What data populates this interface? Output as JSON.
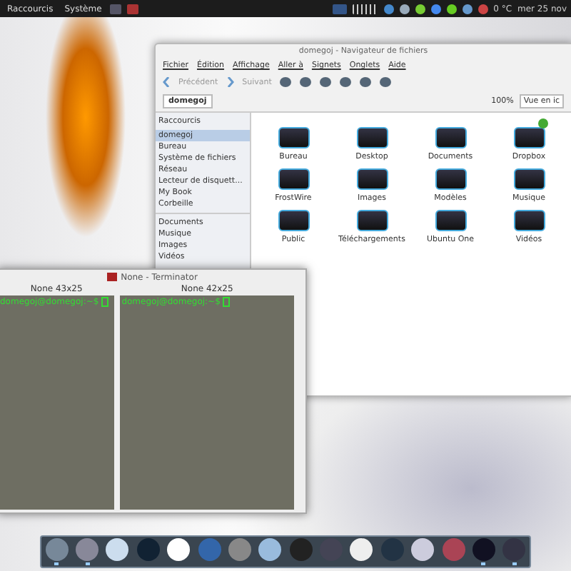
{
  "top_panel": {
    "menus": [
      "Raccourcis",
      "Système"
    ],
    "temperature": "0 °C",
    "clock": "mer 25 nov"
  },
  "file_manager": {
    "title": "domegoj - Navigateur de fichiers",
    "menu": [
      "Fichier",
      "Édition",
      "Affichage",
      "Aller à",
      "Signets",
      "Onglets",
      "Aide"
    ],
    "back": "Précédent",
    "forward": "Suivant",
    "location": "domegoj",
    "zoom": "100%",
    "view": "Vue en ic",
    "sidebar_title": "Raccourcis",
    "sidebar": [
      {
        "label": "domegoj",
        "selected": true
      },
      {
        "label": "Bureau",
        "selected": false
      },
      {
        "label": "Système de fichiers",
        "selected": false
      },
      {
        "label": "Réseau",
        "selected": false
      },
      {
        "label": "Lecteur de disquett...",
        "selected": false
      },
      {
        "label": "My Book",
        "selected": false
      },
      {
        "label": "Corbeille",
        "selected": false
      }
    ],
    "bookmarks": [
      {
        "label": "Documents",
        "selected": false
      },
      {
        "label": "Musique",
        "selected": false
      },
      {
        "label": "Images",
        "selected": false
      },
      {
        "label": "Vidéos",
        "selected": false
      }
    ],
    "items": [
      {
        "label": "Bureau",
        "synced": false
      },
      {
        "label": "Desktop",
        "synced": false
      },
      {
        "label": "Documents",
        "synced": false
      },
      {
        "label": "Dropbox",
        "synced": true
      },
      {
        "label": "FrostWire",
        "synced": false
      },
      {
        "label": "Images",
        "synced": false
      },
      {
        "label": "Modèles",
        "synced": false
      },
      {
        "label": "Musique",
        "synced": false
      },
      {
        "label": "Public",
        "synced": false
      },
      {
        "label": "Téléchargements",
        "synced": false
      },
      {
        "label": "Ubuntu One",
        "synced": false
      },
      {
        "label": "Vidéos",
        "synced": false
      }
    ]
  },
  "terminal": {
    "title": "None - Terminator",
    "panes": [
      {
        "header": "None 43x25",
        "prompt": "domegoj@domegoj:~$"
      },
      {
        "header": "None 42x25",
        "prompt": "domegoj@domegoj:~$"
      }
    ]
  },
  "dock": [
    {
      "running": true
    },
    {
      "running": true
    },
    {
      "running": false
    },
    {
      "running": false
    },
    {
      "running": false
    },
    {
      "running": false
    },
    {
      "running": false
    },
    {
      "running": false
    },
    {
      "running": false
    },
    {
      "running": false
    },
    {
      "running": false
    },
    {
      "running": false
    },
    {
      "running": false
    },
    {
      "running": false
    },
    {
      "running": true
    },
    {
      "running": true
    }
  ]
}
